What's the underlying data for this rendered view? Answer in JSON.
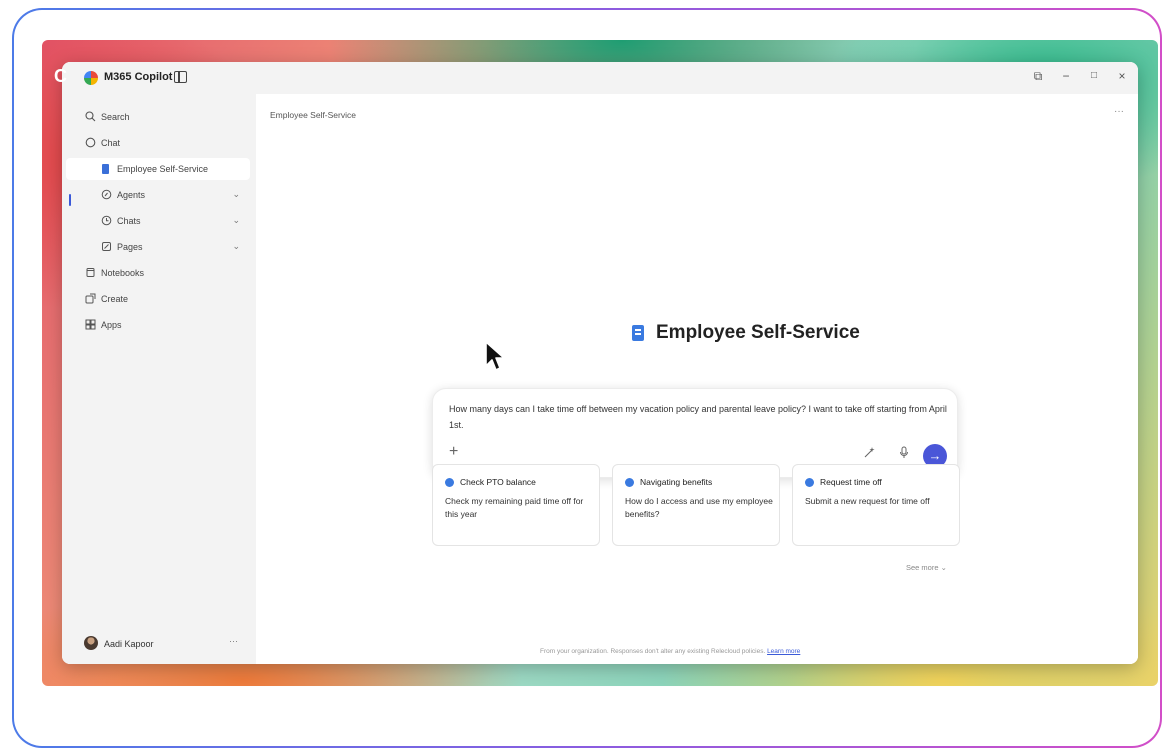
{
  "app": {
    "title": "M365 Copilot"
  },
  "window_controls": {
    "share": "⧉",
    "minimize": "−",
    "maximize": "□",
    "close": "×"
  },
  "sidebar": {
    "items": [
      {
        "label": "Search",
        "icon": "search-icon"
      },
      {
        "label": "Chat",
        "icon": "chat-icon"
      },
      {
        "label": "Employee Self-Service",
        "icon": "ess-icon",
        "active": true
      },
      {
        "label": "Agents",
        "icon": "agents-icon"
      },
      {
        "label": "Chats",
        "icon": "history-icon"
      },
      {
        "label": "Pages",
        "icon": "pages-icon"
      },
      {
        "label": "Notebooks",
        "icon": "notebook-icon"
      },
      {
        "label": "Create",
        "icon": "create-icon"
      },
      {
        "label": "Apps",
        "icon": "apps-icon"
      }
    ],
    "user": {
      "name": "Aadi Kapoor",
      "more": "···"
    }
  },
  "main": {
    "breadcrumb": "Employee Self-Service",
    "more": "···",
    "hero_title": "Employee Self-Service",
    "composer": {
      "text": "How many days can I take time off between my vacation policy and parental leave policy? I want to take off starting from April 1st.",
      "plus": "+",
      "send": "→"
    },
    "cards": [
      {
        "title": "Check PTO balance",
        "desc": "Check my remaining paid time off for this year"
      },
      {
        "title": "Navigating benefits",
        "desc": "How do I access and use my employee benefits?"
      },
      {
        "title": "Request time off",
        "desc": "Submit a new request for time off"
      }
    ],
    "see_more": "See more ⌄",
    "footer": {
      "text": "From your organization. Responses don't alter any existing Relecloud policies.",
      "link": "Learn more"
    }
  }
}
